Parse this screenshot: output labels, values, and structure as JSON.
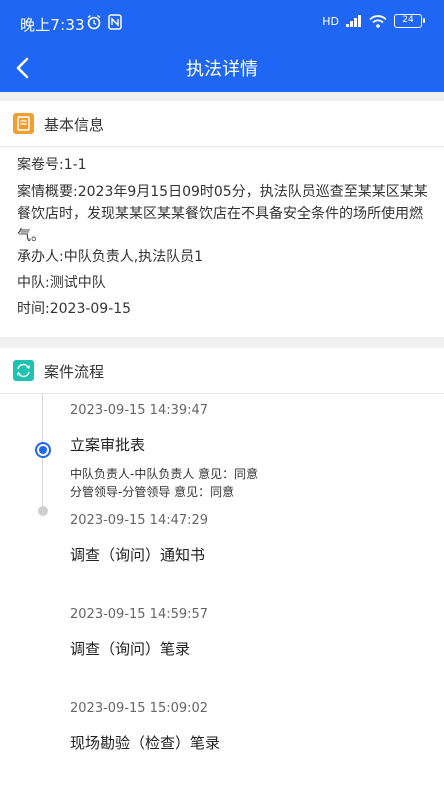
{
  "status": {
    "time": "晚上7:33",
    "network": "HD",
    "battery": "24"
  },
  "nav": {
    "title": "执法详情"
  },
  "basic": {
    "title": "基本信息",
    "case_no": "案卷号:1-1",
    "summary": "案情概要:2023年9月15日09时05分，执法队员巡查至某某区某某餐饮店时，发现某某区某某餐饮店在不具备安全条件的场所使用燃气。",
    "handler": "承办人:中队负责人,执法队员1",
    "squad": "中队:测试中队",
    "date": "时间:2023-09-15"
  },
  "flow": {
    "title": "案件流程",
    "steps": [
      {
        "time": "2023-09-15 14:39:47",
        "name": "立案审批表",
        "notes": [
          "中队负责人-中队负责人 意见：同意",
          "分管领导-分管领导 意见：同意"
        ]
      },
      {
        "time": "2023-09-15 14:47:29",
        "name": "调查（询问）通知书"
      },
      {
        "time": "2023-09-15 14:59:57",
        "name": "调查（询问）笔录"
      },
      {
        "time": "2023-09-15 15:09:02",
        "name": "现场勘验（检查）笔录"
      }
    ]
  },
  "colors": {
    "brand": "#1f66f5",
    "info_icon": "#f0a030",
    "flow_icon": "#1ec2b0"
  }
}
